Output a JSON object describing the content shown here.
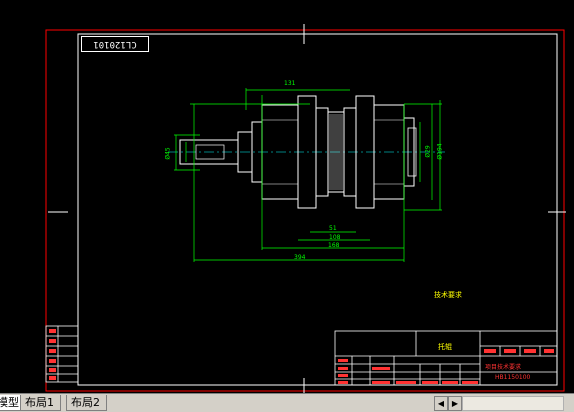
{
  "drawing": {
    "drawing_id": "CL120101",
    "dims": {
      "overall": "394",
      "top": "131",
      "mid1": "51",
      "mid2": "108",
      "mid3": "168",
      "left_dia": "Ø45",
      "right_dia1": "Ø29",
      "right_dia2": "Ø194"
    },
    "tech_req": "技术要求",
    "title_block": {
      "part_name": "托辊",
      "company": "项目技术要求",
      "subtitle": "HB1150100"
    }
  },
  "layout_tabs": [
    {
      "label": "模型"
    },
    {
      "label": "布局1"
    },
    {
      "label": "布局2"
    }
  ],
  "colors": {
    "background": "#000000",
    "border": "#ff0000",
    "frame": "#ffffff",
    "dimension": "#00ff00",
    "centerline": "#00ffff"
  }
}
